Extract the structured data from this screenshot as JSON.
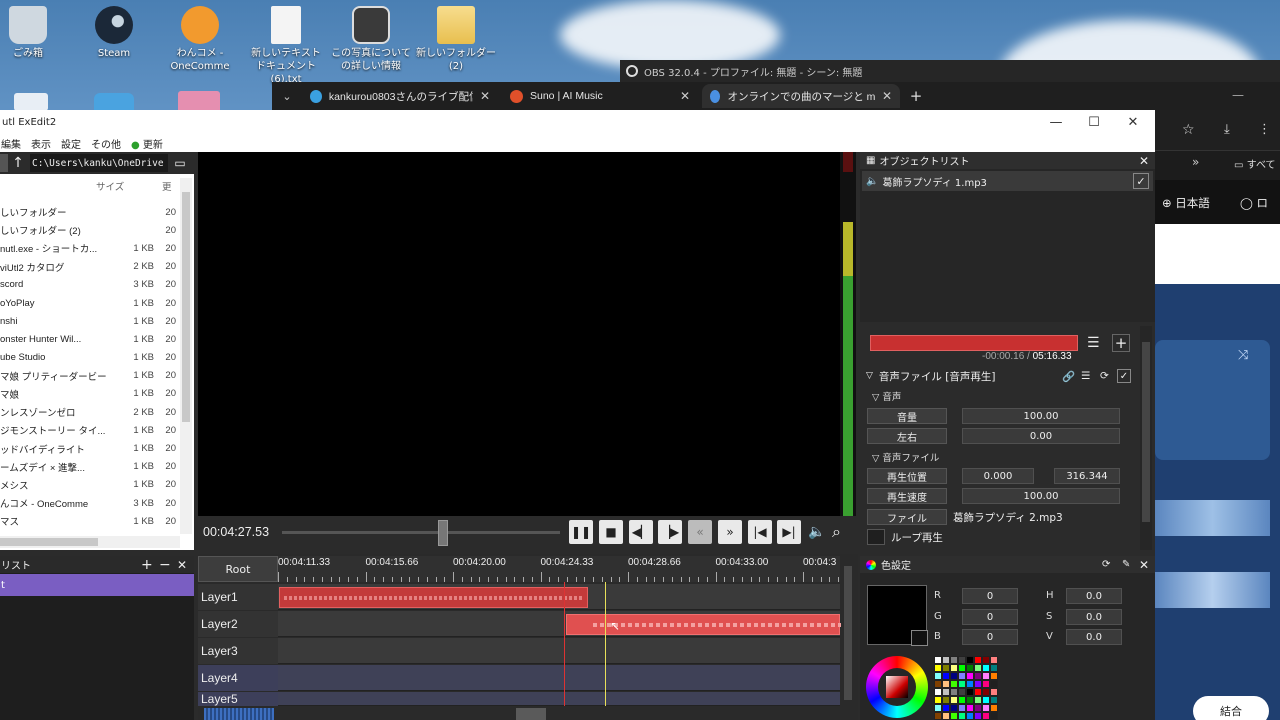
{
  "desktop": {
    "icons": [
      {
        "label": "ごみ箱",
        "color": "#cfd8e0"
      },
      {
        "label": "Steam",
        "color": "#1b2838"
      },
      {
        "label": "わんコメ - OneComme",
        "color": "#f29a2e"
      },
      {
        "label": "新しいテキスト ドキュメント (6).txt",
        "color": "#f2f2f2"
      },
      {
        "label": "この写真についての詳しい情報",
        "color": "#4a4a4a"
      },
      {
        "label": "新しいフォルダー (2)",
        "color": "#f3d27a"
      }
    ]
  },
  "obs": {
    "title": "OBS 32.0.4 - プロファイル: 無題 - シーン: 無題"
  },
  "browser": {
    "tabs": [
      {
        "label": "kankurou0803さんのライブ配信 -",
        "color": "#3aa0e0"
      },
      {
        "label": "Suno | AI Music",
        "color": "#e0502a"
      },
      {
        "label": "オンラインでの曲のマージと mp3 の…",
        "color": "#4a90e2"
      }
    ],
    "new_tab": "+",
    "side": {
      "lang": "日本語",
      "login": "ロ",
      "bookmark": "すべて",
      "merge": "結合"
    }
  },
  "exedit": {
    "title": "utl ExEdit2",
    "menu": [
      "編集",
      "表示",
      "設定",
      "その他",
      "更新"
    ],
    "window_controls": [
      "—",
      "☐",
      "✕"
    ]
  },
  "explorer": {
    "path": "C:\\Users\\kanku\\OneDrive",
    "col_size": "サイズ",
    "col_date": "更",
    "rows": [
      {
        "name": "しいフォルダー",
        "size": "",
        "date": "20"
      },
      {
        "name": "しいフォルダー (2)",
        "size": "",
        "date": "20"
      },
      {
        "name": "nutl.exe - ショートカ...",
        "size": "1 KB",
        "date": "20"
      },
      {
        "name": "viUtl2 カタログ",
        "size": "2 KB",
        "date": "20"
      },
      {
        "name": "scord",
        "size": "3 KB",
        "date": "20"
      },
      {
        "name": "oYoPlay",
        "size": "1 KB",
        "date": "20"
      },
      {
        "name": "nshi",
        "size": "1 KB",
        "date": "20"
      },
      {
        "name": "onster Hunter Wil...",
        "size": "1 KB",
        "date": "20"
      },
      {
        "name": "ube Studio",
        "size": "1 KB",
        "date": "20"
      },
      {
        "name": "マ娘 プリティーダービー",
        "size": "1 KB",
        "date": "20"
      },
      {
        "name": "マ娘",
        "size": "1 KB",
        "date": "20"
      },
      {
        "name": "ンレスゾーンゼロ",
        "size": "2 KB",
        "date": "20"
      },
      {
        "name": "ジモンストーリー タイ...",
        "size": "1 KB",
        "date": "20"
      },
      {
        "name": "ッドバイディライト",
        "size": "1 KB",
        "date": "20"
      },
      {
        "name": "ームズデイ × 進撃...",
        "size": "1 KB",
        "date": "20"
      },
      {
        "name": "メシス",
        "size": "1 KB",
        "date": "20"
      },
      {
        "name": "んコメ - OneComme",
        "size": "3 KB",
        "date": "20"
      },
      {
        "name": "マス",
        "size": "1 KB",
        "date": "20"
      }
    ]
  },
  "layer_list": {
    "title": "リスト",
    "item": "t"
  },
  "player": {
    "time": "00:04:27.53",
    "seek_fraction": 0.58
  },
  "timeline": {
    "root": "Root",
    "ticks": [
      "00:04:11.33",
      "00:04:15.66",
      "00:04:20.00",
      "00:04:24.33",
      "00:04:28.66",
      "00:04:33.00",
      "00:04:3"
    ],
    "layers": [
      "Layer1",
      "Layer2",
      "Layer3",
      "Layer4",
      "Layer5"
    ]
  },
  "object_list": {
    "title": "オブジェクトリスト",
    "item": "葛飾ラプソディ 1.mp3",
    "time_current": "-00:00.16",
    "time_sep": "/",
    "time_total": "05:16.33",
    "section": "音声ファイル [音声再生]",
    "group_audio": "音声",
    "volume_label": "音量",
    "volume_value": "100.00",
    "pan_label": "左右",
    "pan_value": "0.00",
    "group_file": "音声ファイル",
    "pos_label": "再生位置",
    "pos_start": "0.000",
    "pos_end": "316.344",
    "speed_label": "再生速度",
    "speed_value": "100.00",
    "file_label": "ファイル",
    "file_value": "葛飾ラプソディ 2.mp3",
    "loop_label": "ループ再生"
  },
  "color_settings": {
    "title": "色設定",
    "R": "0",
    "G": "0",
    "B": "0",
    "H": "0.0",
    "S": "0.0",
    "V": "0.0"
  }
}
